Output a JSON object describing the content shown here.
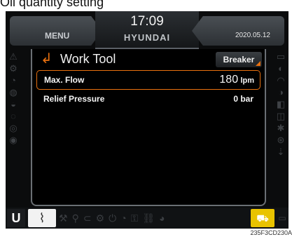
{
  "caption": "Oil quantity setting",
  "figure_code": "235F3CD230A",
  "header": {
    "menu_label": "MENU",
    "time": "17:09",
    "brand": "HYUNDAI",
    "date": "2020.05.12"
  },
  "panel": {
    "title": "Work Tool",
    "mode_button": "Breaker",
    "rows": [
      {
        "label": "Max. Flow",
        "value": "180",
        "unit": "lpm",
        "selected": true
      },
      {
        "label": "Relief Pressure",
        "value": "0 bar",
        "selected": false
      }
    ]
  },
  "footer": {
    "u_label": "U",
    "seat_icon": "seat-icon",
    "turtle_icon": "turtle-icon",
    "accent_color": "#e9c300"
  },
  "colors": {
    "accent_orange": "#e8700f",
    "background": "#0b0c0d"
  }
}
